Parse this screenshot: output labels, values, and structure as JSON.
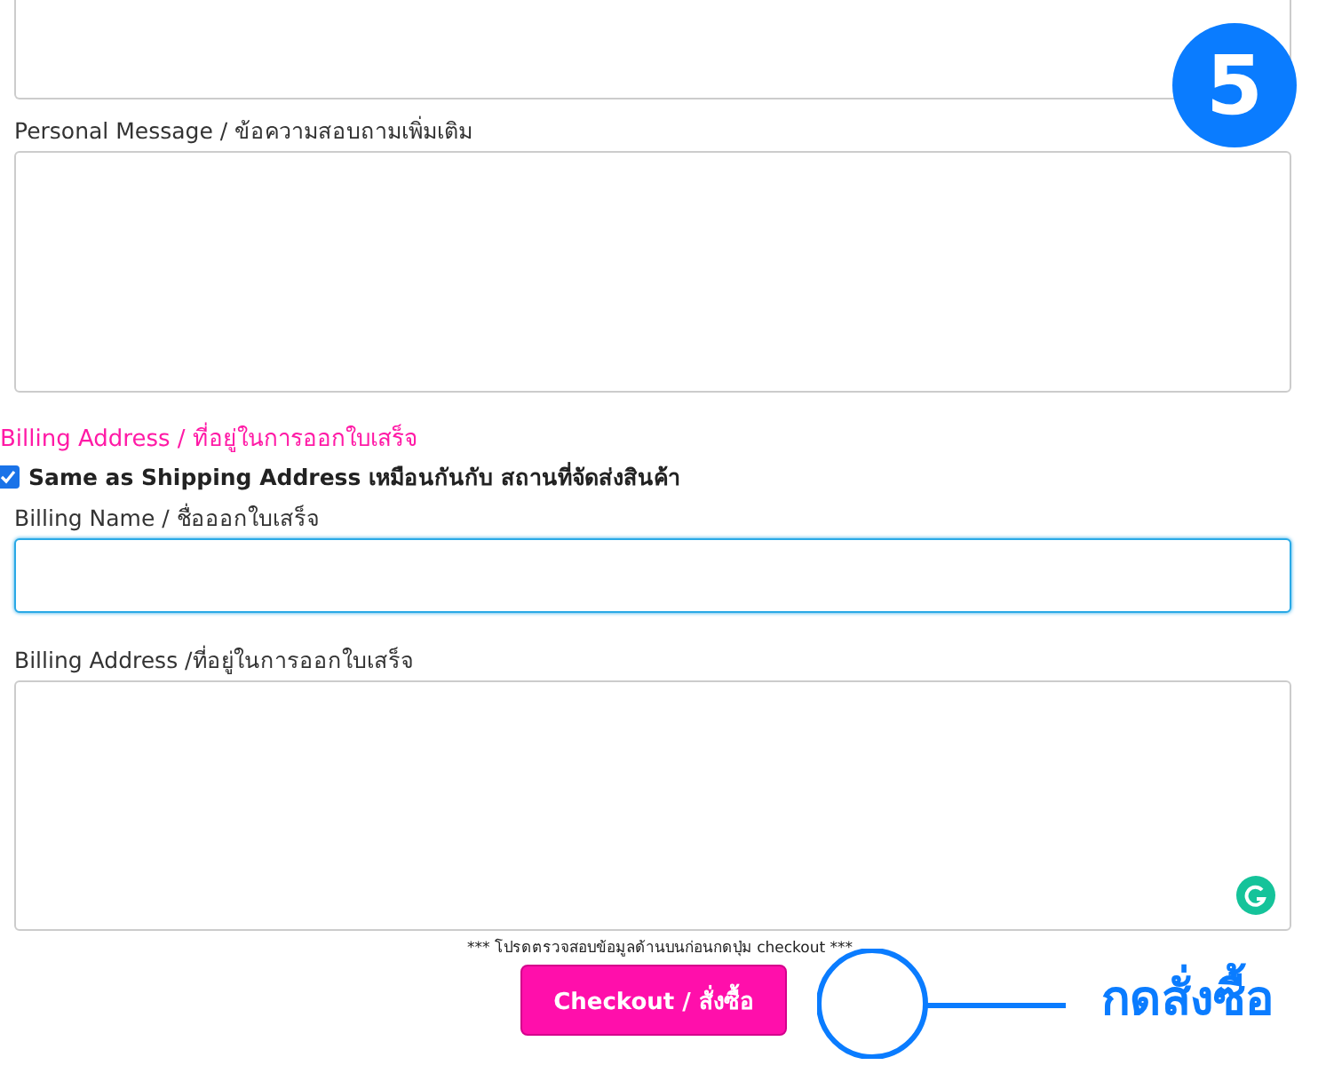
{
  "fields": [
    {
      "kind": "textarea",
      "label": "Personal Message / ข้อความสอบถามเพิ่มเติม",
      "focused": false
    }
  ],
  "billing": {
    "heading": "Billing Address / ที่อยู่ในการออกใบเสร็จ",
    "same_as_shipping": {
      "label": "Same as Shipping Address เหมือนกันกับ สถานที่จัดส่งสินค้า",
      "checked": true
    },
    "fields": [
      {
        "kind": "input",
        "label": "Billing Name / ชื่อออกใบเสร็จ",
        "focused": true
      },
      {
        "kind": "textarea",
        "label": "Billing Address /ที่อยู่ในการออกใบเสร็จ",
        "focused": false,
        "grammarly": true
      }
    ]
  },
  "note": "*** โปรดตรวจสอบข้อมูลด้านบนก่อนกดปุ่ม checkout ***",
  "checkout_button": "Checkout / สั่งซื้อ",
  "step_badge": "5",
  "annotation": "กดสั่งซื้อ"
}
